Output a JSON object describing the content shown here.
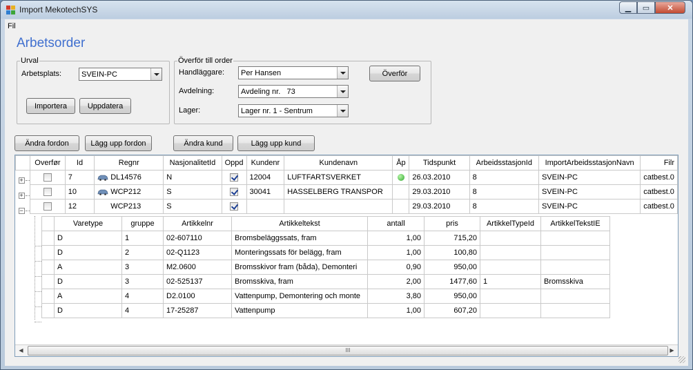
{
  "window": {
    "title": "Import MekotechSYS"
  },
  "menu": {
    "file": "Fil"
  },
  "page": {
    "heading": "Arbetsorder"
  },
  "urval": {
    "legend": "Urval",
    "arbetsplats_label": "Arbetsplats:",
    "arbetsplats_value": "SVEIN-PC",
    "import_button": "Importera",
    "update_button": "Uppdatera"
  },
  "transfer": {
    "legend": "Överför till order",
    "handlaggare_label": "Handläggare:",
    "handlaggare_value": "Per Hansen",
    "avdelning_label": "Avdelning:",
    "avdelning_value": "Avdeling nr.   73",
    "lager_label": "Lager:",
    "lager_value": "Lager nr. 1 - Sentrum",
    "transfer_button": "Överför"
  },
  "toolbar": {
    "change_vehicle": "Ändra fordon",
    "add_vehicle": "Lägg upp fordon",
    "change_customer": "Ändra kund",
    "add_customer": "Lägg upp kund"
  },
  "grid": {
    "columns": [
      "Overfør",
      "Id",
      "Regnr",
      "NasjonalitetId",
      "Oppd",
      "Kundenr",
      "Kundenavn",
      "Åp",
      "Tidspunkt",
      "ArbeidsstasjonId",
      "ImportArbeidsstasjonNavn",
      "Filr"
    ],
    "rows": [
      {
        "expander": "+",
        "id": "7",
        "regnr": "DL14576",
        "nasjonalitet": "N",
        "oppd": true,
        "kundenr": "12004",
        "kundenavn": "LUFTFARTSVERKET",
        "ap": true,
        "tidspunkt": "26.03.2010",
        "arbeidsstasjon_id": "8",
        "import_navn": "SVEIN-PC",
        "fil": "catbest.0"
      },
      {
        "expander": "+",
        "id": "10",
        "regnr": "WCP212",
        "nasjonalitet": "S",
        "oppd": true,
        "kundenr": "30041",
        "kundenavn": "HASSELBERG TRANSPOR",
        "ap": false,
        "tidspunkt": "29.03.2010",
        "arbeidsstasjon_id": "8",
        "import_navn": "SVEIN-PC",
        "fil": "catbest.0"
      },
      {
        "expander": "−",
        "id": "12",
        "regnr": "WCP213",
        "nasjonalitet": "S",
        "oppd": true,
        "kundenr": "",
        "kundenavn": "",
        "ap": false,
        "tidspunkt": "29.03.2010",
        "arbeidsstasjon_id": "8",
        "import_navn": "SVEIN-PC",
        "fil": "catbest.0"
      }
    ]
  },
  "subgrid": {
    "columns": [
      "Varetype",
      "gruppe",
      "Artikkelnr",
      "Artikkeltekst",
      "antall",
      "pris",
      "ArtikkelTypeId",
      "ArtikkelTekstIE"
    ],
    "rows": [
      [
        "D",
        "1",
        "02-607110",
        "Bromsbeläggssats, fram",
        "1,00",
        "715,20",
        "",
        ""
      ],
      [
        "D",
        "2",
        "02-Q1123",
        "Monteringssats för belägg, fram",
        "1,00",
        "100,80",
        "",
        ""
      ],
      [
        "A",
        "3",
        "M2.0600",
        "Bromsskivor fram (båda), Demonteri",
        "0,90",
        "950,00",
        "",
        ""
      ],
      [
        "D",
        "3",
        "02-525137",
        "Bromsskiva, fram",
        "2,00",
        "1477,60",
        "1",
        "Bromsskiva"
      ],
      [
        "A",
        "4",
        "D2.0100",
        "Vattenpump, Demontering och monte",
        "3,80",
        "950,00",
        "",
        ""
      ],
      [
        "D",
        "4",
        "17-25287",
        "Vattenpump",
        "1,00",
        "607,20",
        "",
        ""
      ]
    ]
  },
  "scrollbar": {
    "grip": "III"
  }
}
